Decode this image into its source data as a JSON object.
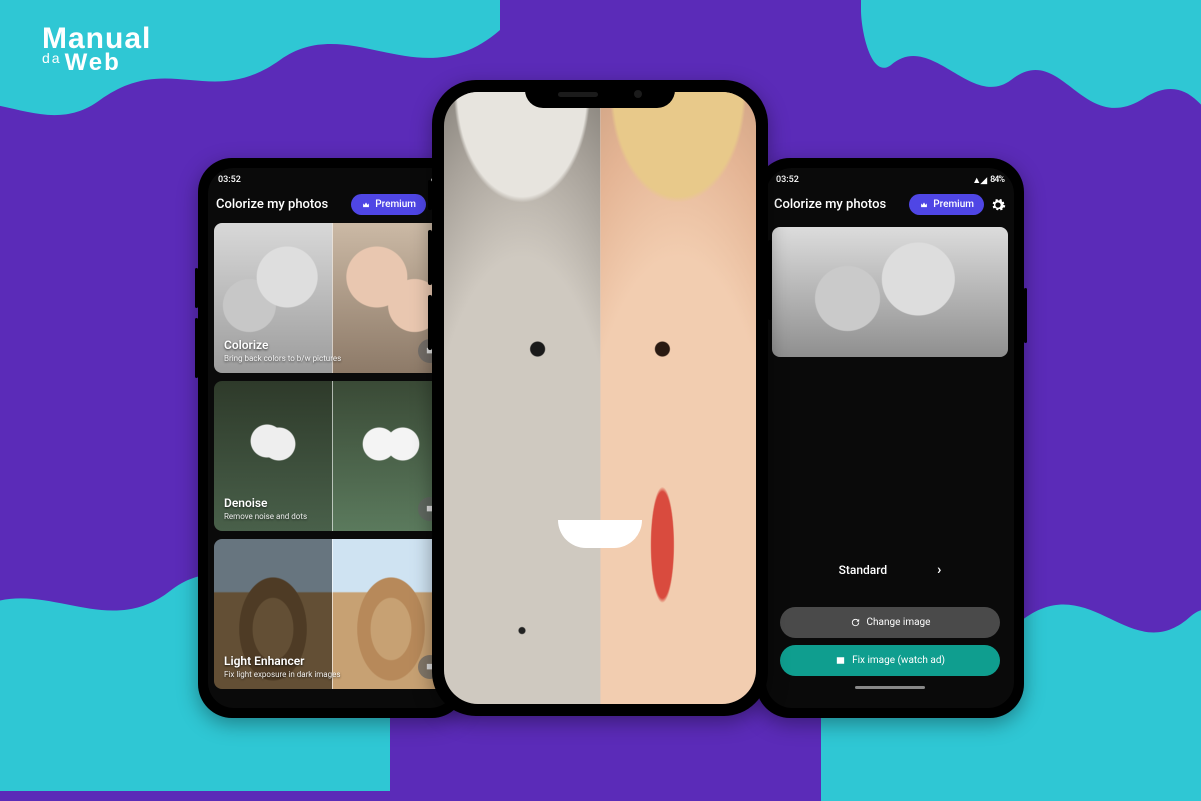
{
  "brand": {
    "line1": "Manual",
    "da": "da",
    "line2": "Web"
  },
  "phoneLeft": {
    "status": {
      "time": "03:52",
      "icons": "▲◢◑"
    },
    "header": {
      "title": "Colorize my photos",
      "premium": "Premium"
    },
    "cards": [
      {
        "title": "Colorize",
        "desc": "Bring back colors to b/w pictures"
      },
      {
        "title": "Denoise",
        "desc": "Remove noise and dots"
      },
      {
        "title": "Light Enhancer",
        "desc": "Fix light exposure in dark images"
      }
    ]
  },
  "phoneRight": {
    "status": {
      "time": "03:52",
      "icons": "▲◢",
      "battery": "84%"
    },
    "header": {
      "title": "Colorize my photos",
      "premium": "Premium"
    },
    "quality": "Standard",
    "buttons": {
      "change": "Change image",
      "fix": "Fix image (watch ad)"
    }
  }
}
